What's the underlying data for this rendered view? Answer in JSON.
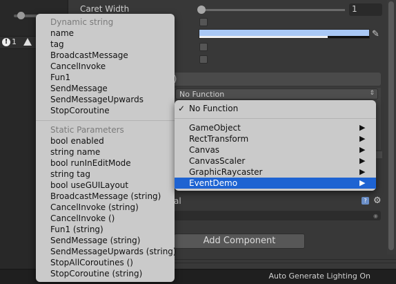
{
  "inspector": {
    "caret_label": "Caret Width",
    "caret_value": "1",
    "event_header": "g)",
    "function_select": "No Function",
    "function_arrows": "⇕",
    "section_tail": "al",
    "add_component": "Add Component",
    "help_glyph": "?",
    "gear_glyph": "⚙",
    "eyedropper_glyph": "✎",
    "color_swatch": "#a9c8f5"
  },
  "left_panel": {
    "warning_count": "1",
    "warning_glyph": "!"
  },
  "statusbar": {
    "text": "Auto Generate Lighting On"
  },
  "dynamic_menu": {
    "dynamic_header": "Dynamic string",
    "dynamic_items": [
      "name",
      "tag",
      "BroadcastMessage",
      "CancelInvoke",
      "Fun1",
      "SendMessage",
      "SendMessageUpwards",
      "StopCoroutine"
    ],
    "static_header": "Static Parameters",
    "static_items": [
      "bool enabled",
      "string name",
      "bool runInEditMode",
      "string tag",
      "bool useGUILayout",
      "BroadcastMessage (string)",
      "CancelInvoke (string)",
      "CancelInvoke ()",
      "Fun1 (string)",
      "SendMessage (string)",
      "SendMessageUpwards (string)",
      "StopAllCoroutines ()",
      "StopCoroutine (string)"
    ]
  },
  "function_menu": {
    "checkmark": "✓",
    "no_function": "No Function",
    "submenu_arrow": "▶",
    "items": [
      "GameObject",
      "RectTransform",
      "Canvas",
      "CanvasScaler",
      "GraphicRaycaster",
      "EventDemo"
    ],
    "selected_index": 5,
    "selected_color": "#1e63d2"
  }
}
